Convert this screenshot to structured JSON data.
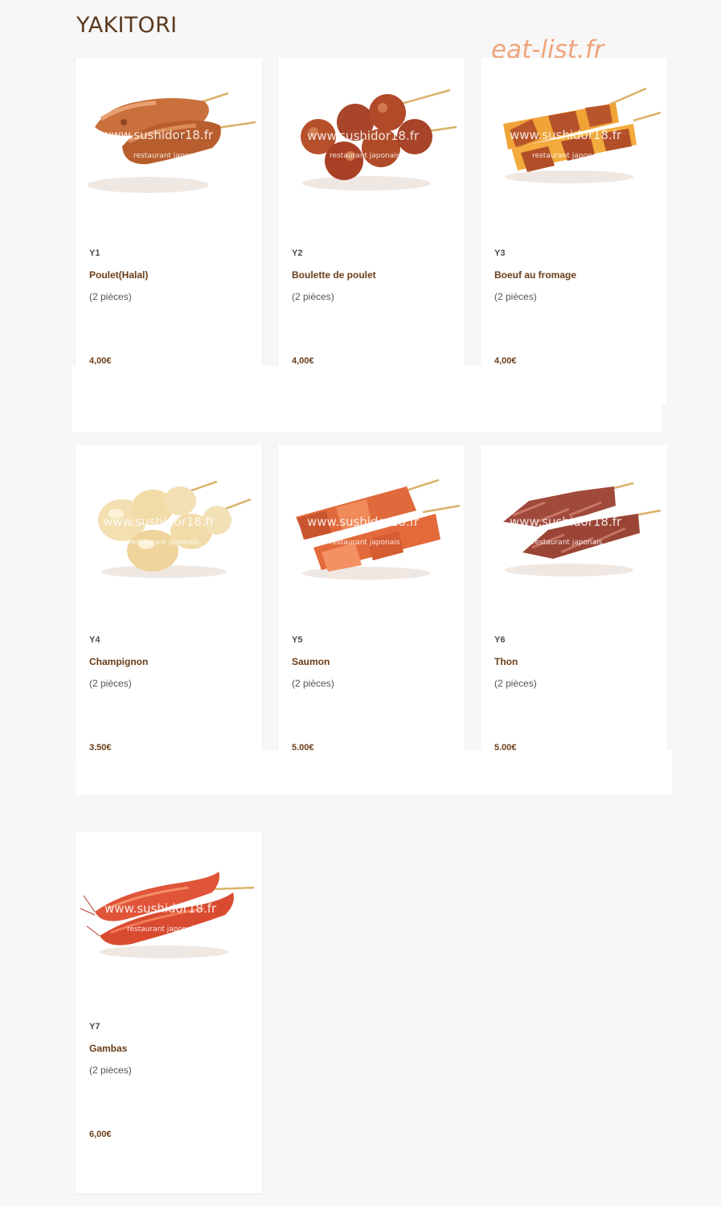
{
  "section": {
    "title": "YAKITORI"
  },
  "watermark": "eat-list.fr",
  "image_watermark": {
    "site": "www.sushidor18.fr",
    "tagline": "restaurant japonais"
  },
  "items": [
    {
      "code": "Y1",
      "name": "Poulet(Halal)",
      "qty": "(2 pièces)",
      "price": "4,00€",
      "icon": "chicken-skewer"
    },
    {
      "code": "Y2",
      "name": "Boulette de poulet",
      "qty": "(2 pièces)",
      "price": "4,00€",
      "icon": "meatball-skewer"
    },
    {
      "code": "Y3",
      "name": "Boeuf au fromage",
      "qty": "(2 pièces)",
      "price": "4,00€",
      "icon": "beef-cheese-skewer"
    },
    {
      "code": "Y4",
      "name": "Champignon",
      "qty": "(2 pièces)",
      "price": "3,50€",
      "icon": "mushroom-skewer"
    },
    {
      "code": "Y5",
      "name": "Saumon",
      "qty": "(2 pièces)",
      "price": "5,00€",
      "icon": "salmon-skewer"
    },
    {
      "code": "Y6",
      "name": "Thon",
      "qty": "(2 pièces)",
      "price": "5,00€",
      "icon": "tuna-skewer"
    },
    {
      "code": "Y7",
      "name": "Gambas",
      "qty": "(2 pièces)",
      "price": "6,00€",
      "icon": "shrimp-skewer"
    }
  ]
}
